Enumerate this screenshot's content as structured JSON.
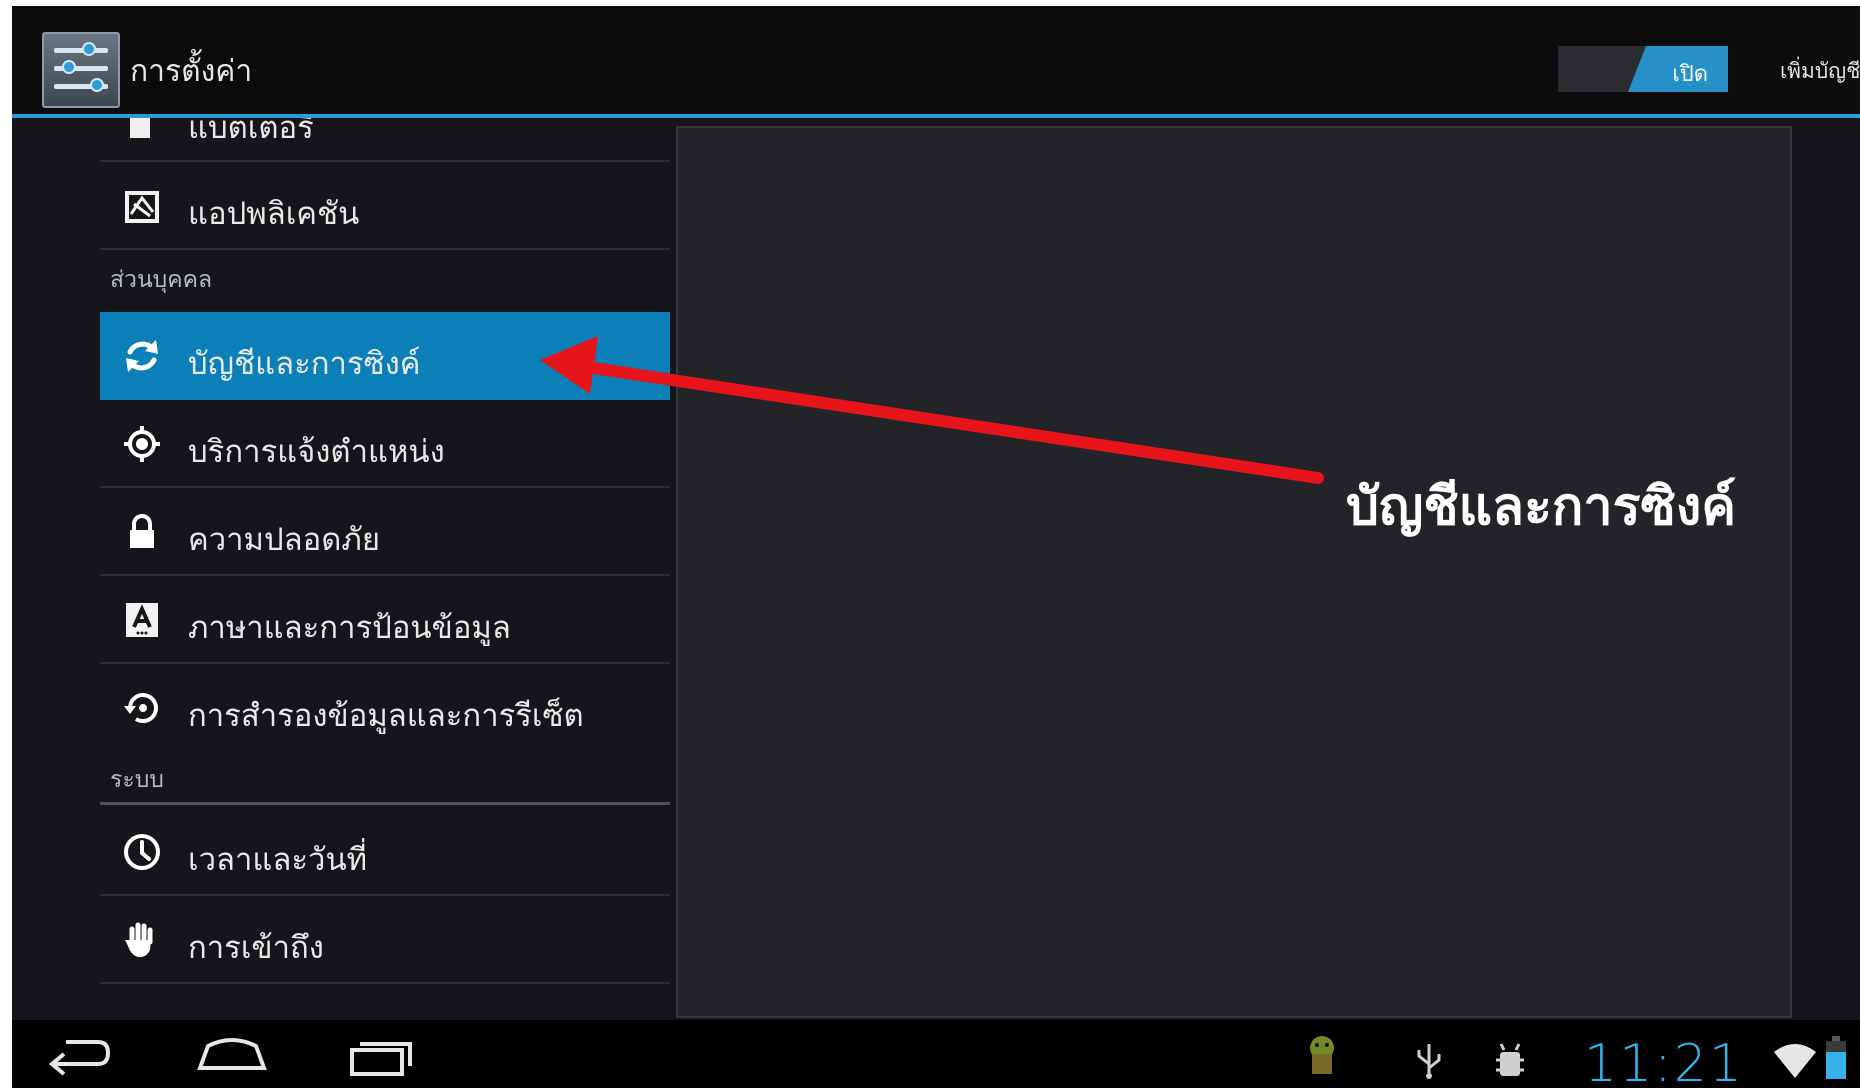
{
  "action_bar": {
    "title": "การตั้งค่า",
    "sync_toggle_label": "เปิด",
    "sync_toggle_on": true,
    "add_account_label": "เพิ่มบัญชี"
  },
  "settings_list": {
    "partial_top_item": "แบตเตอรี่",
    "apps_item": "แอปพลิเคชัน",
    "personal_header": "ส่วนบุคคล",
    "personal_items": [
      {
        "label": "บัญชีและการซิงค์",
        "icon": "sync-icon",
        "selected": true
      },
      {
        "label": "บริการแจ้งตำแหน่ง",
        "icon": "location-icon",
        "selected": false
      },
      {
        "label": "ความปลอดภัย",
        "icon": "lock-icon",
        "selected": false
      },
      {
        "label": "ภาษาและการป้อนข้อมูล",
        "icon": "language-icon",
        "selected": false
      },
      {
        "label": "การสำรองข้อมูลและการรีเซ็ต",
        "icon": "backup-reset-icon",
        "selected": false
      }
    ],
    "system_header": "ระบบ",
    "system_items": [
      {
        "label": "เวลาและวันที่",
        "icon": "clock-icon"
      },
      {
        "label": "การเข้าถึง",
        "icon": "accessibility-hand-icon"
      }
    ]
  },
  "annotation": {
    "label": "บัญชีและการซิงค์",
    "color": "#e8141c"
  },
  "nav_bar": {
    "buttons": [
      "back-icon",
      "home-icon",
      "recent-apps-icon"
    ],
    "status_icons": [
      "android-notification-icon",
      "usb-icon",
      "debug-icon",
      "wifi-icon",
      "battery-icon"
    ],
    "clock": "11:21"
  },
  "colors": {
    "accent": "#2a9ad8",
    "selected_row": "#0b7fb7",
    "background": "#151619",
    "clock": "#35b2ea"
  }
}
